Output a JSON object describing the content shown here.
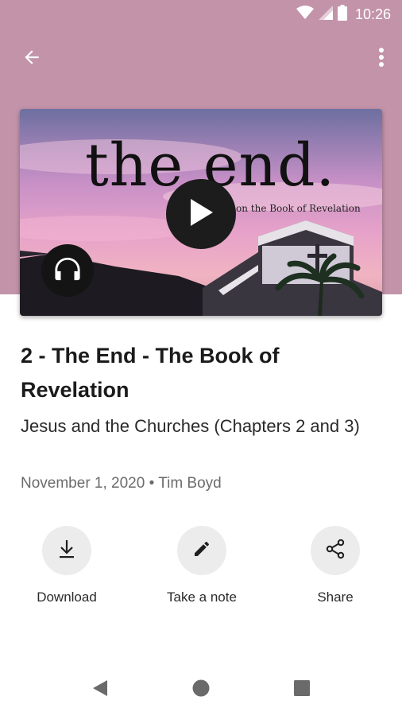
{
  "status_bar": {
    "time": "10:26",
    "icons": [
      "wifi-icon",
      "signal-icon",
      "battery-icon"
    ]
  },
  "app_bar": {
    "back_icon": "arrow-left-icon",
    "menu_icon": "more-vert-icon"
  },
  "artwork": {
    "title_text": "the end.",
    "subtitle_text": "on the Book of Revelation",
    "play_icon": "play-icon",
    "audio_icon": "headphones-icon"
  },
  "sermon": {
    "title": "2 - The End - The Book of Revelation",
    "subtitle": "Jesus and the Churches (Chapters 2 and 3)",
    "date": "November 1, 2020",
    "separator": "•",
    "speaker": "Tim Boyd"
  },
  "actions": [
    {
      "label": "Download",
      "icon": "download-icon"
    },
    {
      "label": "Take a note",
      "icon": "pencil-icon"
    },
    {
      "label": "Share",
      "icon": "share-icon"
    }
  ],
  "nav_bar": {
    "icons": [
      "back-triangle-icon",
      "home-circle-icon",
      "recents-square-icon"
    ]
  },
  "colors": {
    "header": "#c393a9",
    "action_circle": "#ececec",
    "text_dark": "#1b1b1b",
    "text_meta": "#6b6b6b"
  }
}
